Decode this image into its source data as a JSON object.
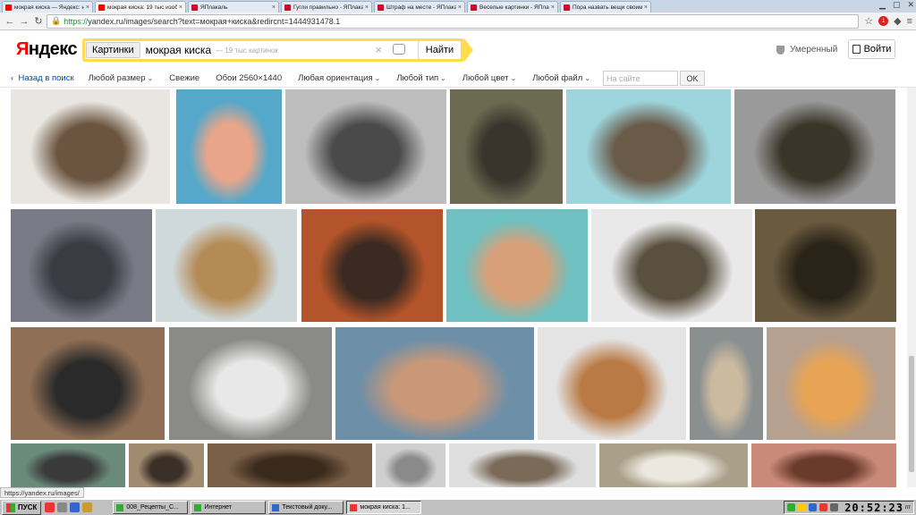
{
  "browser": {
    "tabs": [
      {
        "label": "мокрая киска — Яндекс: н",
        "fav": "y",
        "active": false
      },
      {
        "label": "мокрая киска: 19 тыс изоб",
        "fav": "y",
        "active": true
      },
      {
        "label": "ЯПлакаль",
        "fav": "m",
        "active": false
      },
      {
        "label": "Гугли правильно - ЯПлака",
        "fav": "m",
        "active": false
      },
      {
        "label": "Штраф на месте - ЯПлака",
        "fav": "m",
        "active": false
      },
      {
        "label": "Веселые картинки - ЯПлак",
        "fav": "m",
        "active": false
      },
      {
        "label": "Пора назвать вещи своим",
        "fav": "m",
        "active": false
      }
    ],
    "url_scheme": "https://",
    "url_rest": "yandex.ru/images/search?text=мокрая+киска&redircnt=1444931478.1",
    "ext_badge": "1"
  },
  "header": {
    "logo_ya": "Я",
    "logo_rest": "ндекс",
    "search_tag": "Картинки",
    "query": "мокрая киска",
    "hint": "— 19 тыс картинок",
    "find_label": "Найти",
    "safesearch_label": "Умеренный",
    "login_label": "Войти"
  },
  "filters": {
    "back_label": "Назад в поиск",
    "items": [
      "Любой размер",
      "Свежие",
      "Обои 2560×1440",
      "Любая ориентация",
      "Любой тип",
      "Любой цвет",
      "Любой файл"
    ],
    "site_placeholder": "На сайте",
    "ok_label": "OK"
  },
  "status_url": "https://yandex.ru/images/",
  "taskbar": {
    "start_label": "ПУСК",
    "tasks": [
      {
        "label": "008_Рецепты_С...",
        "active": false,
        "color": "#3a3"
      },
      {
        "label": "Интернет",
        "active": false,
        "color": "#3a3"
      },
      {
        "label": "Текстовый доку...",
        "active": false,
        "color": "#36c"
      },
      {
        "label": "мокрая киска: 1...",
        "active": true,
        "color": "#e33"
      }
    ],
    "clock": "20:52:23",
    "day": "пт"
  },
  "colors": {
    "yandex_yellow": "#ffdb4d",
    "link_blue": "#0044bb",
    "logo_red": "#ff0000"
  },
  "thumbnails": [
    {
      "name": "cat-snow"
    },
    {
      "name": "girl-bikini-cat"
    },
    {
      "name": "wet-grey-cat"
    },
    {
      "name": "wet-kitten-sitting"
    },
    {
      "name": "cat-stretched-bath"
    },
    {
      "name": "tabby-cat-wet-street"
    },
    {
      "name": "wet-cat-towel"
    },
    {
      "name": "cat-in-bath-water"
    },
    {
      "name": "cat-wrapped-towel"
    },
    {
      "name": "bikini-splash"
    },
    {
      "name": "cat-holding-bath-edge"
    },
    {
      "name": "cat-in-sink-drain"
    },
    {
      "name": "wet-black-cat-held"
    },
    {
      "name": "white-cat-sink"
    },
    {
      "name": "woman-rain"
    },
    {
      "name": "cat-in-tub"
    },
    {
      "name": "fluffy-cat-shower"
    },
    {
      "name": "kitten-screaming"
    },
    {
      "name": "kitten-bottom-1"
    },
    {
      "name": "cat-bottom-2"
    },
    {
      "name": "cat-bottom-3"
    },
    {
      "name": "cat-bottom-4"
    },
    {
      "name": "cat-bottom-5"
    },
    {
      "name": "cat-bottom-6"
    },
    {
      "name": "cat-bottom-7"
    }
  ]
}
